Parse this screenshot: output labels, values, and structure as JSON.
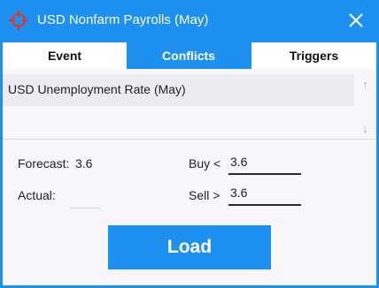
{
  "window": {
    "title": "USD Nonfarm Payrolls (May)",
    "title_icon": "crosshair-icon",
    "close_icon": "close-icon",
    "accent_color": "#1e90f0"
  },
  "tabs": [
    {
      "label": "Event",
      "active": false
    },
    {
      "label": "Conflicts",
      "active": true
    },
    {
      "label": "Triggers",
      "active": false
    }
  ],
  "conflicts_list": {
    "items": [
      "USD Unemployment Rate (May)"
    ],
    "scroll_up_icon": "arrow-up-icon",
    "scroll_down_icon": "arrow-down-icon"
  },
  "form": {
    "forecast_label": "Forecast:",
    "forecast_value": "3.6",
    "actual_label": "Actual:",
    "actual_value": "",
    "buy_label": "Buy <",
    "buy_value": "3.6",
    "sell_label": "Sell >",
    "sell_value": "3.6"
  },
  "load_button": {
    "label": "Load"
  }
}
